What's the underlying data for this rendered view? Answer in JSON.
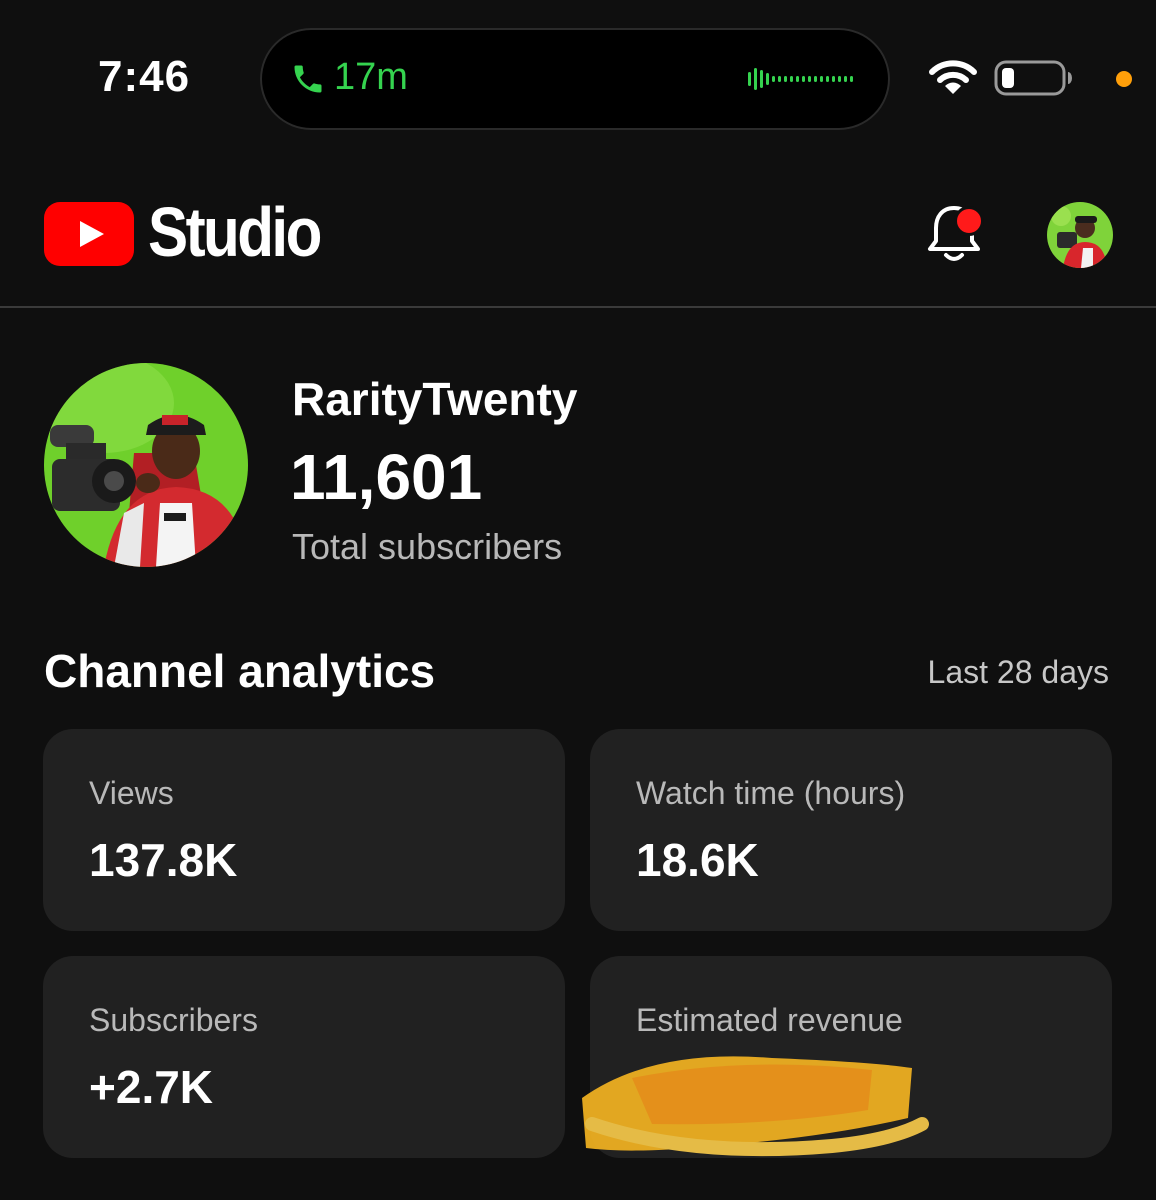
{
  "status_bar": {
    "time": "7:46",
    "call_duration": "17m",
    "icons": [
      "phone-icon",
      "audio-wave-icon",
      "wifi-icon",
      "battery-icon",
      "privacy-indicator-dot"
    ]
  },
  "header": {
    "logo_word": "Studio",
    "has_notification": true
  },
  "channel": {
    "name": "RarityTwenty",
    "subscriber_count": "11,601",
    "subscriber_label": "Total subscribers"
  },
  "analytics": {
    "title": "Channel analytics",
    "period": "Last 28 days",
    "cards": [
      {
        "label": "Views",
        "value": "137.8K"
      },
      {
        "label": "Watch time (hours)",
        "value": "18.6K"
      },
      {
        "label": "Subscribers",
        "value": "+2.7K"
      },
      {
        "label": "Estimated revenue",
        "value": ""
      }
    ]
  },
  "colors": {
    "background": "#0f0f0f",
    "card": "#212121",
    "youtube_red": "#ff0000",
    "call_green": "#35d34f",
    "redaction": "#f6b422"
  }
}
